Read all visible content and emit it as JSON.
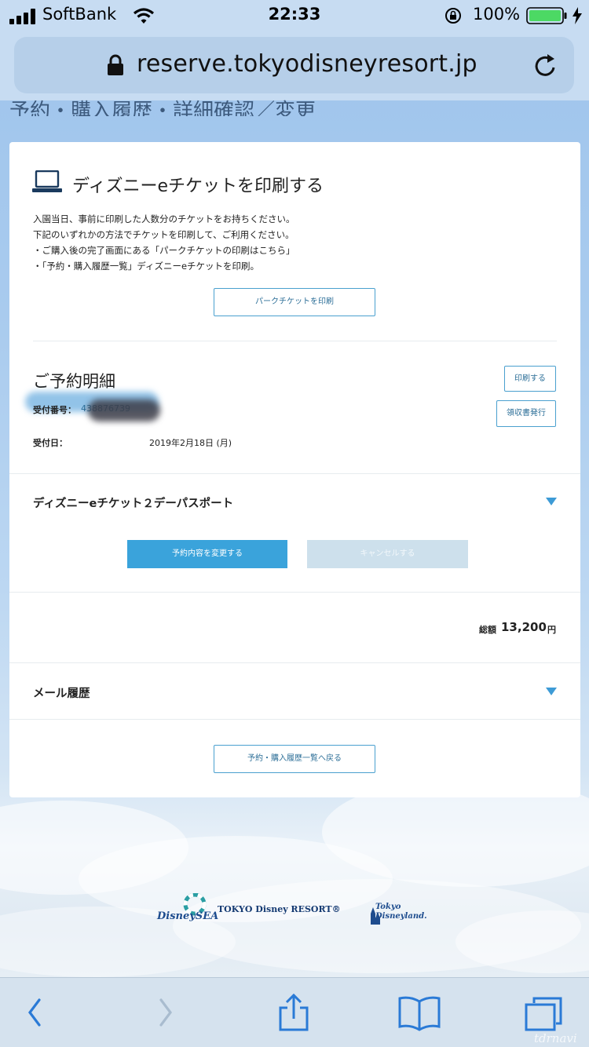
{
  "status_bar": {
    "carrier": "SoftBank",
    "time": "22:33",
    "battery": "100%"
  },
  "browser": {
    "url": "reserve.tokyodisneyresort.jp"
  },
  "page": {
    "header_cut": "予約・購入履歴・詳細確認／変更"
  },
  "print_section": {
    "title": "ディズニーeチケットを印刷する",
    "lines": [
      "入園当日、事前に印刷した人数分のチケットをお持ちください。",
      "下記のいずれかの方法でチケットを印刷して、ご利用ください。",
      "・ご購入後の完了画面にある「パークチケットの印刷はこちら」",
      "・「予約・購入履歴一覧」ディズニーeチケットを印刷。"
    ],
    "park_ticket_button": "パークチケットを印刷"
  },
  "reservation": {
    "title": "ご予約明細",
    "print_button": "印刷する",
    "receipt_button": "領収書発行",
    "receipt_no_label": "受付番号：",
    "receipt_no_value": "438876739",
    "date_label": "受付日：",
    "date_value": "2019年2月18日 (月)"
  },
  "ticket": {
    "title": "ディズニーeチケット２デーパスポート",
    "change_button": "予約内容を変更する",
    "cancel_button": "キャンセルする"
  },
  "total": {
    "label": "総額",
    "value": "13,200",
    "unit": "円"
  },
  "mail": {
    "title": "メール履歴"
  },
  "back_button": "予約・購入履歴一覧へ戻る",
  "footer_logos": {
    "sea": "DisneySEA",
    "resort": "TOKYO Disney RESORT®",
    "land": "Tokyo Disneyland."
  },
  "watermark": "tdrnavi",
  "colors": {
    "accent": "#3aa3db",
    "button_border": "#4aa0cf",
    "disabled": "#cde0ec"
  }
}
